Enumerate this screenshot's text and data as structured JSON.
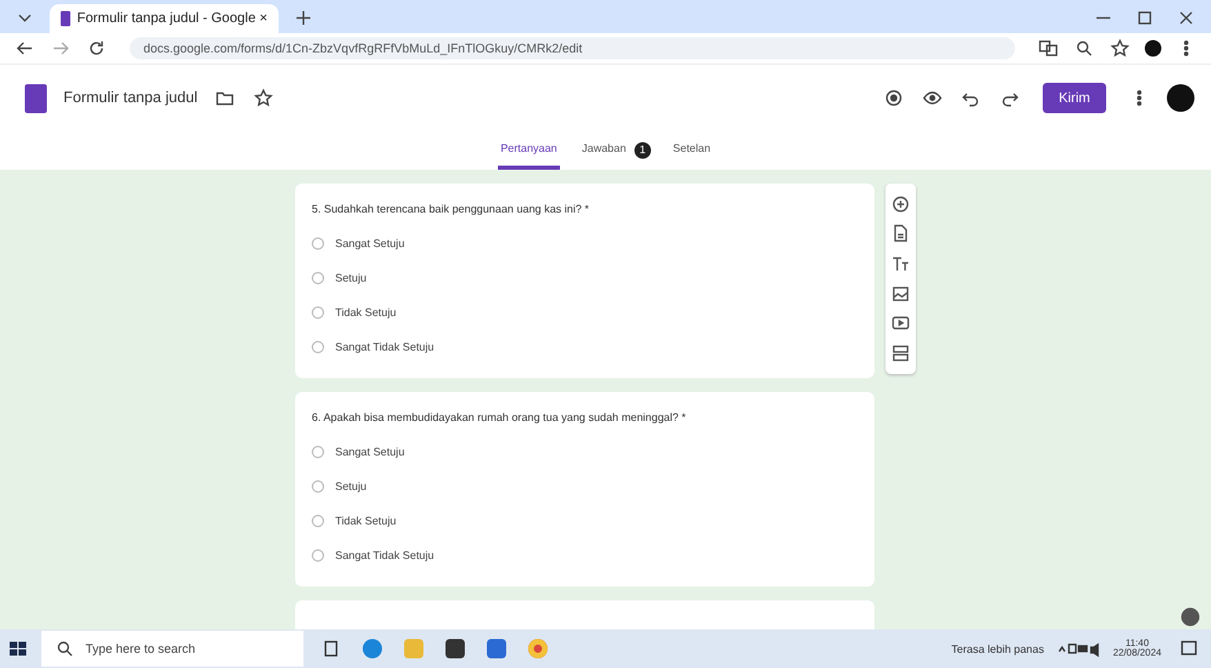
{
  "browser": {
    "tab_title": "Formulir tanpa judul - Google ×",
    "url": "docs.google.com/forms/d/1Cn-ZbzVqvfRgRFfVbMuLd_IFnTlOGkuy/CMRk2/edit"
  },
  "header": {
    "title": "Formulir tanpa judul",
    "send_button": "Kirim"
  },
  "tabs": [
    {
      "label": "Pertanyaan",
      "selected": true
    },
    {
      "label": "Jawaban",
      "selected": false,
      "badge": "1"
    },
    {
      "label": "Setelan",
      "selected": false
    }
  ],
  "questions": [
    {
      "text": "5. Sudahkah terencana baik penggunaan uang kas ini? *",
      "options": [
        {
          "label": "Sangat Setuju",
          "selected": false
        },
        {
          "label": "Setuju",
          "selected": false
        },
        {
          "label": "Tidak Setuju",
          "selected": false
        },
        {
          "label": "Sangat Tidak Setuju",
          "selected": false
        }
      ]
    },
    {
      "text": "6. Apakah bisa membudidayakan rumah orang tua yang sudah meninggal? *",
      "options": [
        {
          "label": "Sangat Setuju",
          "selected": false
        },
        {
          "label": "Setuju",
          "selected": false
        },
        {
          "label": "Tidak Setuju",
          "selected": false
        },
        {
          "label": "Sangat Tidak Setuju",
          "selected": false
        }
      ]
    }
  ],
  "taskbar": {
    "search_placeholder": "Type here to search",
    "weather": "Terasa lebih panas",
    "time": "11:40",
    "date": "22/08/2024"
  }
}
